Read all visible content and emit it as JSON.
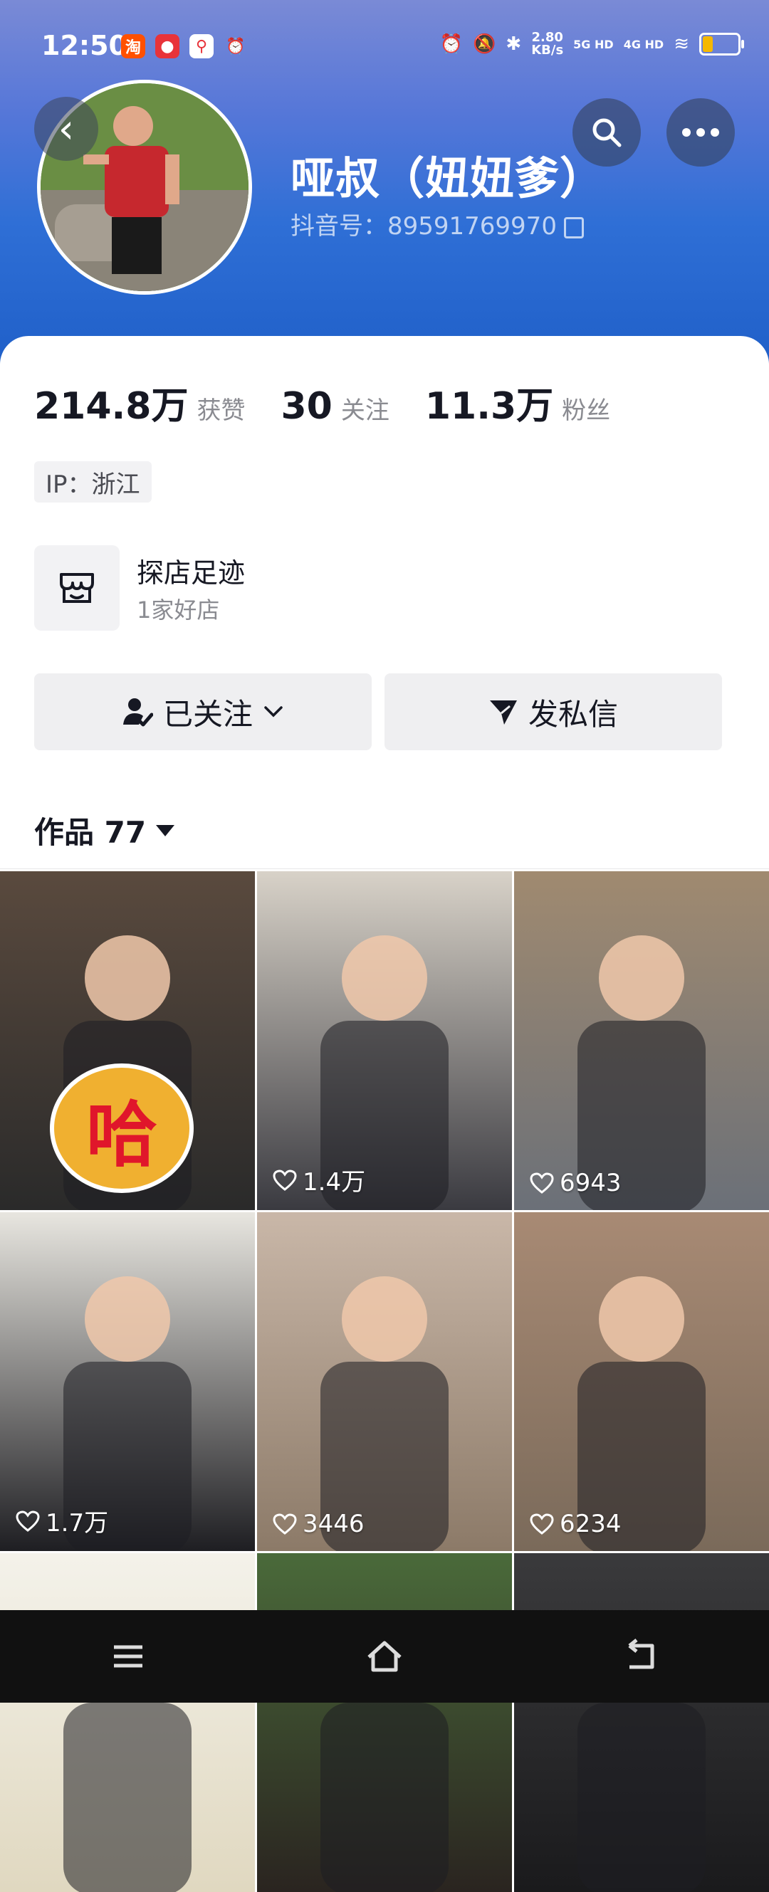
{
  "status_bar": {
    "time": "12:50",
    "net_speed_top": "2.80",
    "net_speed_bottom": "KB/s",
    "signal1": "5G HD",
    "signal2": "4G HD",
    "app_icons": [
      "taobao-icon",
      "app-icon",
      "map-pin-icon",
      "alarm-icon"
    ]
  },
  "profile": {
    "name": "哑叔（妞妞爹）",
    "douyin_id_label": "抖音号：",
    "douyin_id": "89591769970",
    "stats": [
      {
        "num": "214.8万",
        "label": "获赞"
      },
      {
        "num": "30",
        "label": "关注"
      },
      {
        "num": "11.3万",
        "label": "粉丝"
      }
    ],
    "ip": "IP：浙江",
    "shop_title": "探店足迹",
    "shop_sub": "1家好店"
  },
  "actions": {
    "follow_label": "已关注",
    "message_label": "发私信"
  },
  "works": {
    "tab_label": "作品 77",
    "tiles": [
      {
        "likes": "",
        "colors": [
          "#5a4a3e",
          "#2a2a2a"
        ]
      },
      {
        "likes": "1.4万",
        "colors": [
          "#d8d2c8",
          "#3a3a40"
        ]
      },
      {
        "likes": "6943",
        "colors": [
          "#a08a70",
          "#6b7078"
        ]
      },
      {
        "likes": "1.7万",
        "colors": [
          "#e8e6e0",
          "#1e1e22"
        ]
      },
      {
        "likes": "3446",
        "colors": [
          "#c9b7a8",
          "#8c7a68"
        ]
      },
      {
        "likes": "6234",
        "colors": [
          "#a88a74",
          "#7a6a5a"
        ]
      },
      {
        "likes": "",
        "colors": [
          "#f4f2ea",
          "#e0d8c0"
        ]
      },
      {
        "likes": "",
        "colors": [
          "#4a6a3a",
          "#2a2420"
        ]
      },
      {
        "likes": "",
        "colors": [
          "#3a3a3c",
          "#1a1a1c"
        ]
      }
    ]
  },
  "accent": "#161823",
  "hero_colors": [
    "#7a8ad6",
    "#1f5fc8"
  ]
}
